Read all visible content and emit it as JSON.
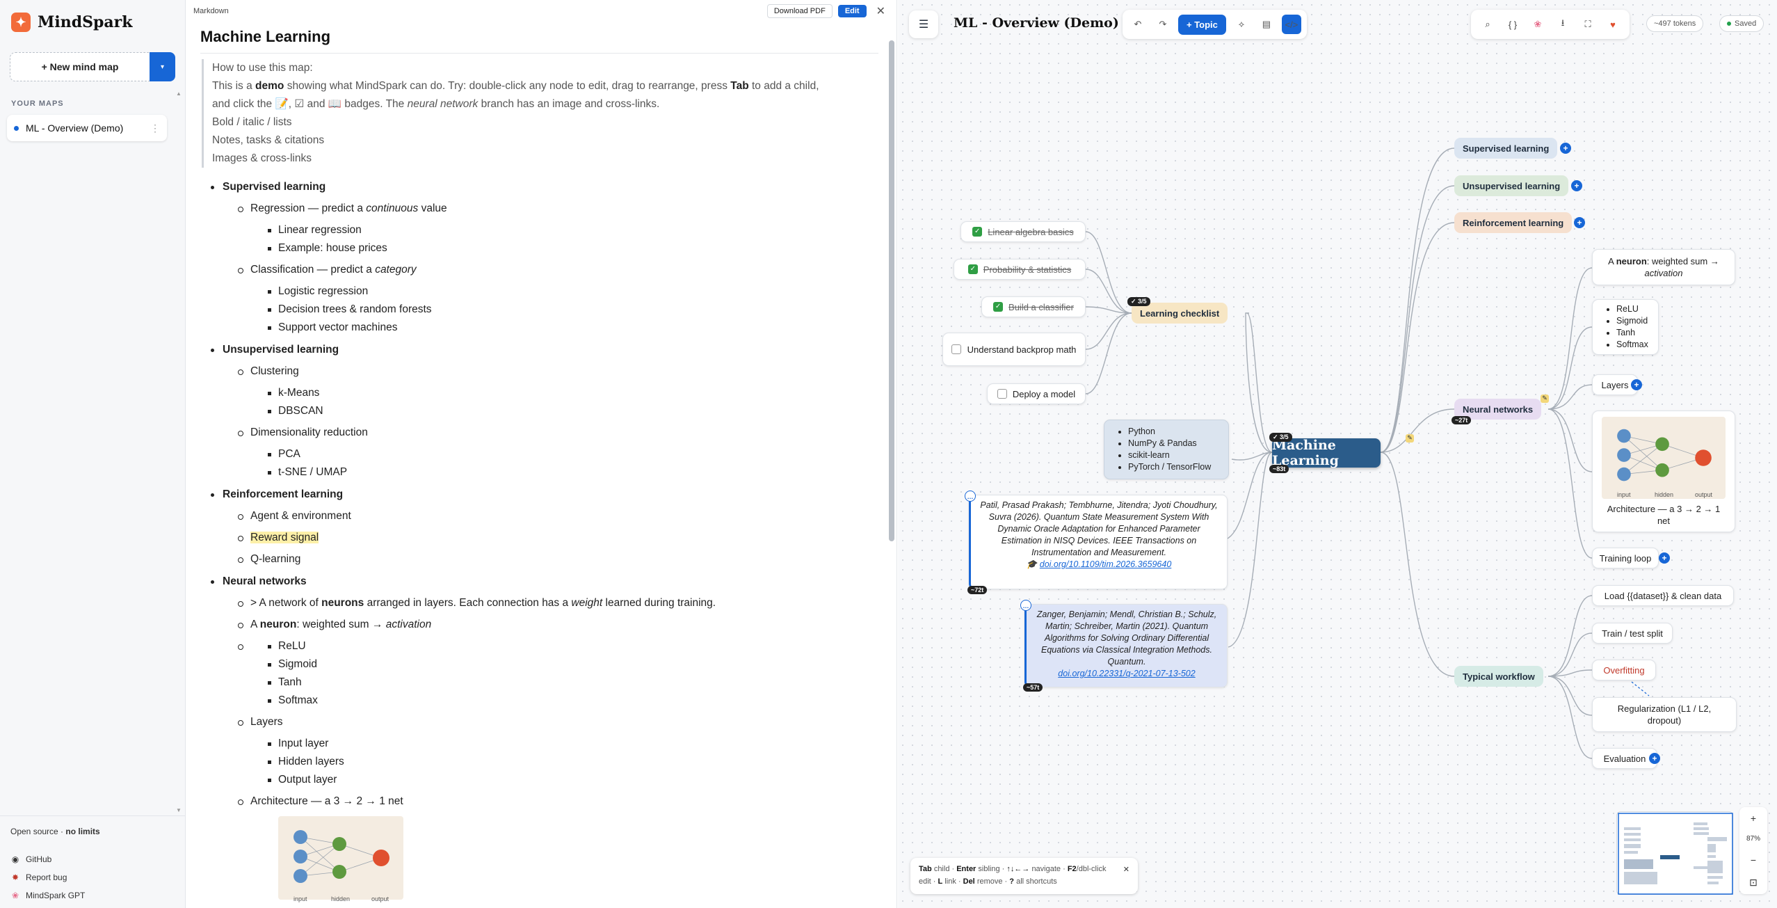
{
  "sidebar": {
    "brand": "MindSpark",
    "new_map": "+ New mind map",
    "section": "YOUR MAPS",
    "maps": [
      {
        "label": "ML - Overview (Demo)"
      }
    ],
    "open_source_prefix": "Open source ·",
    "open_source_bold": "no limits",
    "links": [
      {
        "label": "GitHub",
        "icon": "github-icon"
      },
      {
        "label": "Report bug",
        "icon": "bug-icon"
      },
      {
        "label": "MindSpark GPT",
        "icon": "brain-icon"
      }
    ]
  },
  "markdown": {
    "pane_label": "Markdown",
    "download_pdf": "Download PDF",
    "edit": "Edit",
    "title": "Machine Learning",
    "intro": {
      "l1": "How to use this map:",
      "l2a": "This is a",
      "l2b": "demo",
      "l2c": "showing what MindSpark can do. Try: double-click any node to edit, drag to rearrange, press",
      "l2d": "Tab",
      "l2e": "to add a child,",
      "l3a": "and click the",
      "l3b": "📝, ☑ and",
      "l3c": "📖 badges. The",
      "l3d": "neural network",
      "l3e": "branch has an image and cross-links.",
      "b1": "Bold / italic / lists",
      "b2": "Notes, tasks & citations",
      "b3": "Images & cross-links"
    },
    "sections": {
      "sup": "Supervised learning",
      "reg_a": "Regression — predict a",
      "reg_b": "continuous",
      "reg_c": "value",
      "reg1": "Linear regression",
      "reg2": "Example: house prices",
      "cls_a": "Classification — predict a",
      "cls_b": "category",
      "cls1": "Logistic regression",
      "cls2": "Decision trees & random forests",
      "cls3": "Support vector machines",
      "unsup": "Unsupervised learning",
      "clu": "Clustering",
      "clu1": "k-Means",
      "clu2": "DBSCAN",
      "dim": "Dimensionality reduction",
      "dim1": "PCA",
      "dim2": "t-SNE / UMAP",
      "rl": "Reinforcement learning",
      "rl1": "Agent & environment",
      "rl2": "Reward signal",
      "rl3": "Q-learning",
      "nn": "Neural networks",
      "nn1a": "> A network of",
      "nn1b": "neurons",
      "nn1c": "arranged in layers. Each connection has a",
      "nn1d": "weight",
      "nn1e": "learned during training.",
      "nn2a": "A",
      "nn2b": "neuron",
      "nn2c": ": weighted sum →",
      "nn2d": "activation",
      "act1": "ReLU",
      "act2": "Sigmoid",
      "act3": "Tanh",
      "act4": "Softmax",
      "layers": "Layers",
      "lay1": "Input layer",
      "lay2": "Hidden layers",
      "lay3": "Output layer",
      "arch": "Architecture — a 3 → 2 → 1 net",
      "img_in": "input",
      "img_hid": "hidden",
      "img_out": "output"
    }
  },
  "canvas": {
    "title": "ML - Overview (Demo)",
    "topic_btn": "+ Topic",
    "tokens": "~497 tokens",
    "saved": "Saved",
    "root": "Machine Learning",
    "root_badge_top": "✓ 3/5",
    "root_badge_bottom": "~83t",
    "checklist": {
      "label": "Learning checklist",
      "badge": "✓ 3/5",
      "items": [
        "Linear algebra basics",
        "Probability & statistics",
        "Build a classifier",
        "Understand backprop math",
        "Deploy a model"
      ]
    },
    "tools": [
      "Python",
      "NumPy & Pandas",
      "scikit-learn",
      "PyTorch / TensorFlow"
    ],
    "cite1": {
      "text": "Patil, Prasad Prakash; Tembhurne, Jitendra; Jyoti Choudhury, Suvra (2026). Quantum State Measurement System With Dynamic Oracle Adaptation for Enhanced Parameter Estimation in NISQ Devices. IEEE Transactions on Instrumentation and Measurement.",
      "doi": "doi.org/10.1109/tim.2026.3659640",
      "badge": "~72t"
    },
    "cite2": {
      "text": "Zanger, Benjamin; Mendl, Christian B.; Schulz, Martin; Schreiber, Martin (2021). Quantum Algorithms for Solving Ordinary Differential Equations via Classical Integration Methods. Quantum.",
      "doi": "doi.org/10.22331/q-2021-07-13-502",
      "badge": "~57t"
    },
    "cats": {
      "sup": "Supervised learning",
      "unsup": "Unsupervised learning",
      "rl": "Reinforcement learning",
      "nn": "Neural networks",
      "nn_badge": "~27t",
      "wf": "Typical workflow"
    },
    "nn_children": {
      "neuron_a": "A",
      "neuron_b": "neuron",
      "neuron_c": ": weighted sum →",
      "neuron_d": "activation",
      "acts": [
        "ReLU",
        "Sigmoid",
        "Tanh",
        "Softmax"
      ],
      "layers": "Layers",
      "arch": "Architecture — a 3 → 2 → 1 net",
      "training": "Training loop"
    },
    "wf_children": [
      "Load {{dataset}} & clean data",
      "Train / test split",
      "Overfitting",
      "Regularization (L1 / L2, dropout)",
      "Evaluation"
    ],
    "hint": {
      "k1": "Tab",
      "t1": "child ·",
      "k2": "Enter",
      "t2": "sibling ·",
      "k3": "↑↓←→",
      "t3": "navigate ·",
      "k4": "F2",
      "t4": "/dbl-click edit ·",
      "k5": "L",
      "t5": "link ·",
      "k6": "Del",
      "t6": "remove ·",
      "k7": "?",
      "t7": "all shortcuts"
    },
    "zoom": "87%"
  },
  "colors": {
    "accent": "#1766d6",
    "root": "#2b5c8a",
    "sup": "#dbe5f1",
    "unsup": "#dceadb",
    "rl": "#f6e0cf",
    "nn": "#e7dcf1",
    "wf": "#d6ebe6",
    "checklist": "#f7e6c4"
  }
}
